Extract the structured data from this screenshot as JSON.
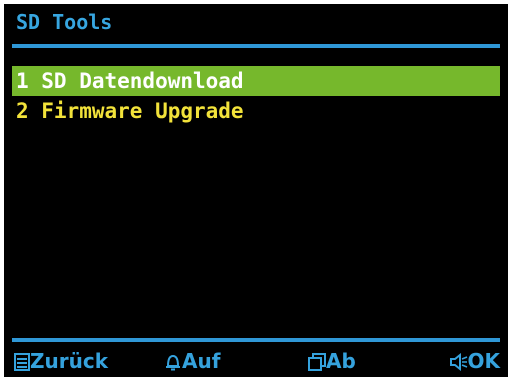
{
  "screen": {
    "title": "SD Tools",
    "menu": [
      {
        "label": "1 SD Datendownload",
        "selected": true
      },
      {
        "label": "2 Firmware Upgrade",
        "selected": false
      }
    ],
    "footer": {
      "back": {
        "icon": "list-icon",
        "label": "Zurück"
      },
      "up": {
        "icon": "bell-icon",
        "label": "Auf"
      },
      "down": {
        "icon": "copy-icon",
        "label": "Ab"
      },
      "ok": {
        "icon": "speaker-icon",
        "label": "OK"
      }
    }
  },
  "colors": {
    "background": "#000000",
    "title": "#37a6e0",
    "rule": "#2f97d6",
    "menu_text": "#f2e23a",
    "selection": "#76b82c",
    "footer": "#35a2dd"
  }
}
